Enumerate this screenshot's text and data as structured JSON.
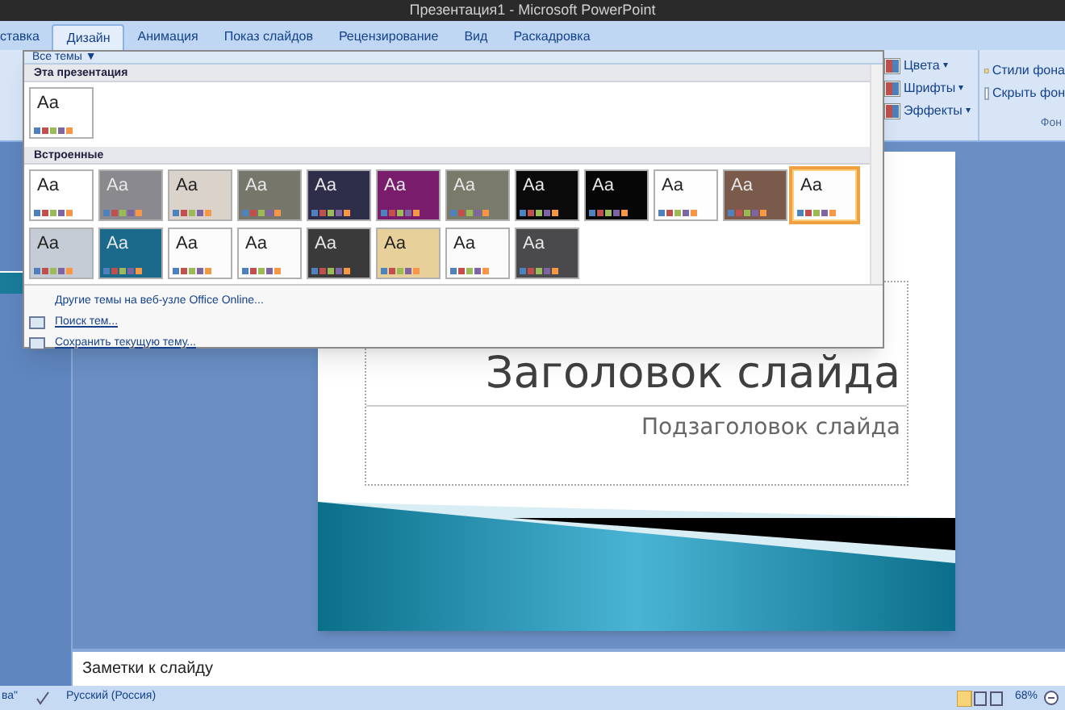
{
  "window": {
    "title": "Презентация1 - Microsoft PowerPoint"
  },
  "tabs": [
    {
      "label": "ставка",
      "selected": false
    },
    {
      "label": "Дизайн",
      "selected": true
    },
    {
      "label": "Анимация",
      "selected": false
    },
    {
      "label": "Показ слайдов",
      "selected": false
    },
    {
      "label": "Рецензирование",
      "selected": false
    },
    {
      "label": "Вид",
      "selected": false
    },
    {
      "label": "Раскадровка",
      "selected": false
    }
  ],
  "ribbon": {
    "theme_options": [
      {
        "label": "Цвета",
        "arrow": "▾"
      },
      {
        "label": "Шрифты",
        "arrow": "▾"
      },
      {
        "label": "Эффекты",
        "arrow": "▾"
      }
    ],
    "background_group": {
      "styles_button": "Стили фона",
      "hide_checkbox": {
        "label": "Скрыть фон",
        "checked": false
      },
      "group_label": "Фон"
    }
  },
  "theme_gallery": {
    "header": "Все темы",
    "header_arrow": "▼",
    "sections": [
      {
        "title": "Эта презентация",
        "themes": [
          {
            "label": "Aa",
            "color": "#ffffff",
            "selected": false
          }
        ]
      },
      {
        "title": "Встроенные",
        "themes": [
          {
            "label": "Aa",
            "color": "#ffffff",
            "selected": false
          },
          {
            "label": "Aa",
            "color": "#8a8a8e",
            "selected": false
          },
          {
            "label": "Aa",
            "color": "#d9d3cc",
            "selected": false
          },
          {
            "label": "Aa",
            "color": "#76776a",
            "selected": false
          },
          {
            "label": "Aa",
            "color": "#2e2e4a",
            "selected": false
          },
          {
            "label": "Aa",
            "color": "#7a1c6c",
            "selected": false
          },
          {
            "label": "Aa",
            "color": "#7a7a6a",
            "selected": false
          },
          {
            "label": "Aa",
            "color": "#0a0a0a",
            "selected": false
          },
          {
            "label": "Aa",
            "color": "#060606",
            "selected": false
          },
          {
            "label": "Aa",
            "color": "#fefefe",
            "selected": false
          },
          {
            "label": "Aa",
            "color": "#7a5a4a",
            "selected": false
          },
          {
            "label": "Aa",
            "color": "#fdfdfd",
            "selected": true
          },
          {
            "label": "Aa",
            "color": "#c6ccd6",
            "selected": false
          },
          {
            "label": "Aa",
            "color": "#1b6a8c",
            "selected": false
          },
          {
            "label": "Aa",
            "color": "#fcfcfc",
            "selected": false
          },
          {
            "label": "Aa",
            "color": "#fbfbfb",
            "selected": false
          },
          {
            "label": "Aa",
            "color": "#3a3a3a",
            "selected": false
          },
          {
            "label": "Aa",
            "color": "#e8d09a",
            "selected": false
          },
          {
            "label": "Aa",
            "color": "#fafafa",
            "selected": false
          },
          {
            "label": "Aa",
            "color": "#4a4a4c",
            "selected": false
          }
        ]
      }
    ],
    "menu": [
      "Другие темы на веб-узле Office Online...",
      "Поиск тем...",
      "Сохранить текущую тему..."
    ]
  },
  "slide": {
    "title": "Заголовок слайда",
    "subtitle": "Подзаголовок слайда"
  },
  "notes": {
    "placeholder": "Заметки к слайду"
  },
  "status_bar": {
    "theme": "ва\"",
    "language": "Русский (Россия)",
    "zoom": "68%"
  }
}
